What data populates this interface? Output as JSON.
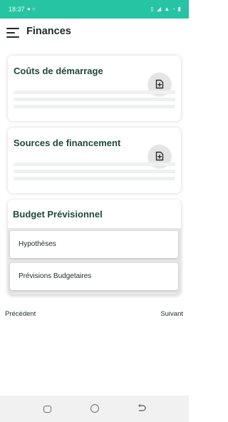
{
  "status_bar": {
    "time": "18:37",
    "left_icons": [
      "chat-icon",
      "messenger-icon"
    ],
    "right_icons": [
      "vibrate-icon",
      "wifi-icon",
      "signal-icon",
      "volte-icon",
      "battery-icon"
    ]
  },
  "header": {
    "menu_icon": "hamburger-menu-icon",
    "title": "Finances"
  },
  "cards": {
    "startup_costs": {
      "title": "Coûts de démarrage",
      "add_icon": "add-document-icon"
    },
    "funding_sources": {
      "title": "Sources de financement",
      "add_icon": "add-document-icon"
    }
  },
  "budget": {
    "title": "Budget Prévisionnel",
    "items": [
      {
        "label": "Hypothèses"
      },
      {
        "label": "Prévisions Budgetaires"
      }
    ]
  },
  "navigation": {
    "previous_label": "Précédent",
    "next_label": "Suivant"
  },
  "system_nav": {
    "buttons": [
      "recents-icon",
      "home-icon",
      "back-icon"
    ]
  },
  "colors": {
    "status_bar": "#27c4a4",
    "card_title": "#1e4a3a",
    "add_button_bg": "#e5e5e5"
  }
}
